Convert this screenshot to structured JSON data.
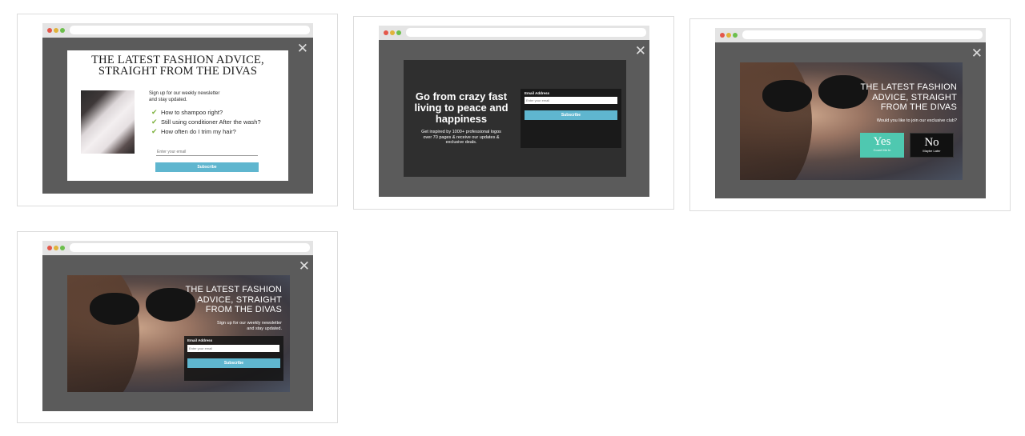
{
  "close_glyph": "✕",
  "check_glyph": "✔",
  "popup1": {
    "title_line1": "THE LATEST FASHION ADVICE,",
    "title_line2": "STRAIGHT FROM THE DIVAS",
    "intro_line1": "Sign up for our weekly newsletter",
    "intro_line2": "and stay updated.",
    "items": [
      "How to shampoo right?",
      "Still using conditioner After the wash?",
      "How often do I trim my hair?"
    ],
    "email_placeholder": "Enter your email",
    "subscribe_label": "Subscribe"
  },
  "popup2": {
    "headline_line1": "Go from crazy fast",
    "headline_line2": "living to peace and",
    "headline_line3": "happiness",
    "sub_line1": "Get inspired by 1000+ professional logos",
    "sub_line2": "over 70 pages & receive our updates &",
    "sub_line3": "exclusive deals.",
    "email_label": "Email Address",
    "email_placeholder": "Enter your email",
    "subscribe_label": "Subscribe"
  },
  "popup3": {
    "title_line1": "THE LATEST FASHION",
    "title_line2": "ADVICE, STRAIGHT",
    "title_line3": "FROM THE DIVAS",
    "question": "Would you like to join our exclusive club?",
    "yes_label": "Yes",
    "yes_sub": "Count Me In",
    "no_label": "No",
    "no_sub": "Maybe Later"
  },
  "popup4": {
    "title_line1": "THE LATEST FASHION",
    "title_line2": "ADVICE, STRAIGHT",
    "title_line3": "FROM THE DIVAS",
    "intro_line1": "Sign up for our weekly newsletter",
    "intro_line2": "and stay updated.",
    "email_label": "Email Address",
    "email_placeholder": "Enter your email",
    "subscribe_label": "Subscribe"
  },
  "colors": {
    "overlay": "#5b5b5b",
    "accent": "#5fb6cf",
    "yes": "#4fc8b0",
    "check": "#7fb241"
  }
}
